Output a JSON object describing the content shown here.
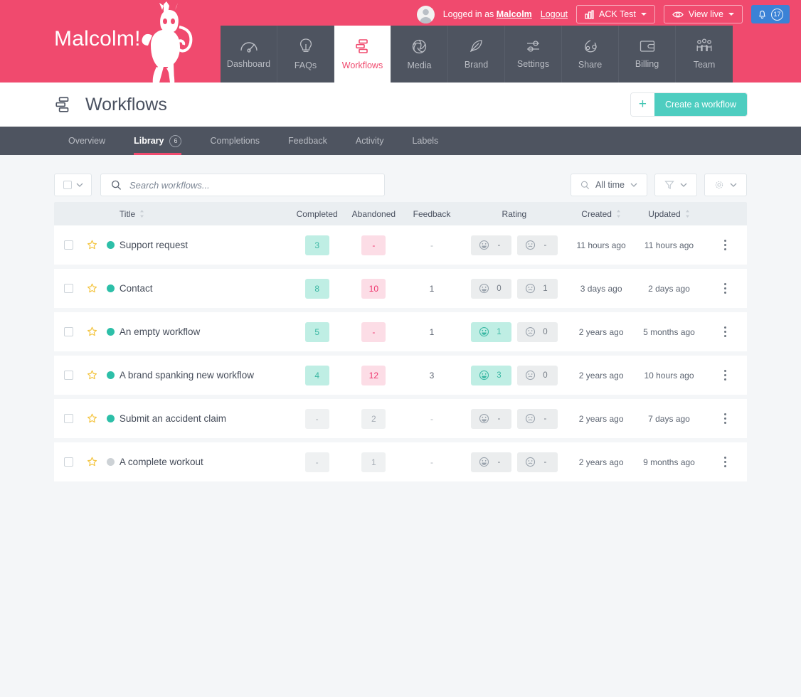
{
  "brand": {
    "name": "Malcolm!",
    "logo_icon": "monkey-logo",
    "accent": "#f04a6e"
  },
  "account": {
    "logged_in_prefix": "Logged in as ",
    "user": "Malcolm",
    "logout": "Logout",
    "site_selector": "ACK Test",
    "view_live": "View live",
    "notifications_count": "17",
    "notification_color": "#3b82d6"
  },
  "mainnav": {
    "items": [
      {
        "label": "Dashboard",
        "icon": "gauge-icon",
        "active": false
      },
      {
        "label": "FAQs",
        "icon": "lightbulb-icon",
        "active": false
      },
      {
        "label": "Workflows",
        "icon": "workflows-icon",
        "active": true
      },
      {
        "label": "Media",
        "icon": "aperture-icon",
        "active": false
      },
      {
        "label": "Brand",
        "icon": "feather-icon",
        "active": false
      },
      {
        "label": "Settings",
        "icon": "sliders-icon",
        "active": false
      },
      {
        "label": "Share",
        "icon": "share-icon",
        "active": false
      },
      {
        "label": "Billing",
        "icon": "wallet-icon",
        "active": false
      },
      {
        "label": "Team",
        "icon": "team-icon",
        "active": false
      }
    ]
  },
  "page": {
    "title": "Workflows",
    "title_icon": "workflows-icon",
    "create_button": "Create a workflow",
    "create_plus": "+",
    "create_color": "#4ecdc0"
  },
  "subnav": {
    "items": [
      {
        "label": "Overview",
        "badge": null,
        "active": false
      },
      {
        "label": "Library",
        "badge": "6",
        "active": true
      },
      {
        "label": "Completions",
        "badge": null,
        "active": false
      },
      {
        "label": "Feedback",
        "badge": null,
        "active": false
      },
      {
        "label": "Activity",
        "badge": null,
        "active": false
      },
      {
        "label": "Labels",
        "badge": null,
        "active": false
      }
    ]
  },
  "toolbar": {
    "select_all_icon": "checkbox-dropdown",
    "search_placeholder": "Search workflows...",
    "search_value": "",
    "search_icon": "search-icon",
    "date_filter": "All time",
    "date_filter_icon": "search-icon",
    "filter_icon": "funnel-icon",
    "settings_icon": "gear-icon"
  },
  "table": {
    "columns": [
      {
        "key": "title",
        "label": "Title",
        "sortable": true
      },
      {
        "key": "completed",
        "label": "Completed",
        "sortable": false
      },
      {
        "key": "abandoned",
        "label": "Abandoned",
        "sortable": false
      },
      {
        "key": "feedback",
        "label": "Feedback",
        "sortable": false
      },
      {
        "key": "rating",
        "label": "Rating",
        "sortable": false
      },
      {
        "key": "created",
        "label": "Created",
        "sortable": true
      },
      {
        "key": "updated",
        "label": "Updated",
        "sortable": true
      }
    ],
    "rows": [
      {
        "checked": false,
        "starred": false,
        "status": "active",
        "title": "Support request",
        "completed": "3",
        "completed_state": "green",
        "abandoned": "-",
        "abandoned_state": "pink",
        "feedback": "-",
        "rating_happy": "-",
        "rating_happy_on": false,
        "rating_sad": "-",
        "rating_sad_on": false,
        "created": "11 hours ago",
        "updated": "11 hours ago"
      },
      {
        "checked": false,
        "starred": false,
        "status": "active",
        "title": "Contact",
        "completed": "8",
        "completed_state": "green",
        "abandoned": "10",
        "abandoned_state": "pink",
        "feedback": "1",
        "rating_happy": "0",
        "rating_happy_on": false,
        "rating_sad": "1",
        "rating_sad_on": false,
        "created": "3 days ago",
        "updated": "2 days ago"
      },
      {
        "checked": false,
        "starred": false,
        "status": "active",
        "title": "An empty workflow",
        "completed": "5",
        "completed_state": "green",
        "abandoned": "-",
        "abandoned_state": "pink",
        "feedback": "1",
        "rating_happy": "1",
        "rating_happy_on": true,
        "rating_sad": "0",
        "rating_sad_on": false,
        "created": "2 years ago",
        "updated": "5 months ago"
      },
      {
        "checked": false,
        "starred": false,
        "status": "active",
        "title": "A brand spanking new workflow",
        "completed": "4",
        "completed_state": "green",
        "abandoned": "12",
        "abandoned_state": "pink",
        "feedback": "3",
        "rating_happy": "3",
        "rating_happy_on": true,
        "rating_sad": "0",
        "rating_sad_on": false,
        "created": "2 years ago",
        "updated": "10 hours ago"
      },
      {
        "checked": false,
        "starred": false,
        "status": "active",
        "title": "Submit an accident claim",
        "completed": "-",
        "completed_state": "grey",
        "abandoned": "2",
        "abandoned_state": "grey",
        "feedback": "-",
        "rating_happy": "-",
        "rating_happy_on": false,
        "rating_sad": "-",
        "rating_sad_on": false,
        "created": "2 years ago",
        "updated": "7 days ago"
      },
      {
        "checked": false,
        "starred": false,
        "status": "inactive",
        "title": "A complete workout",
        "completed": "-",
        "completed_state": "grey",
        "abandoned": "1",
        "abandoned_state": "grey",
        "feedback": "-",
        "rating_happy": "-",
        "rating_happy_on": false,
        "rating_sad": "-",
        "rating_sad_on": false,
        "created": "2 years ago",
        "updated": "9 months ago"
      }
    ]
  }
}
